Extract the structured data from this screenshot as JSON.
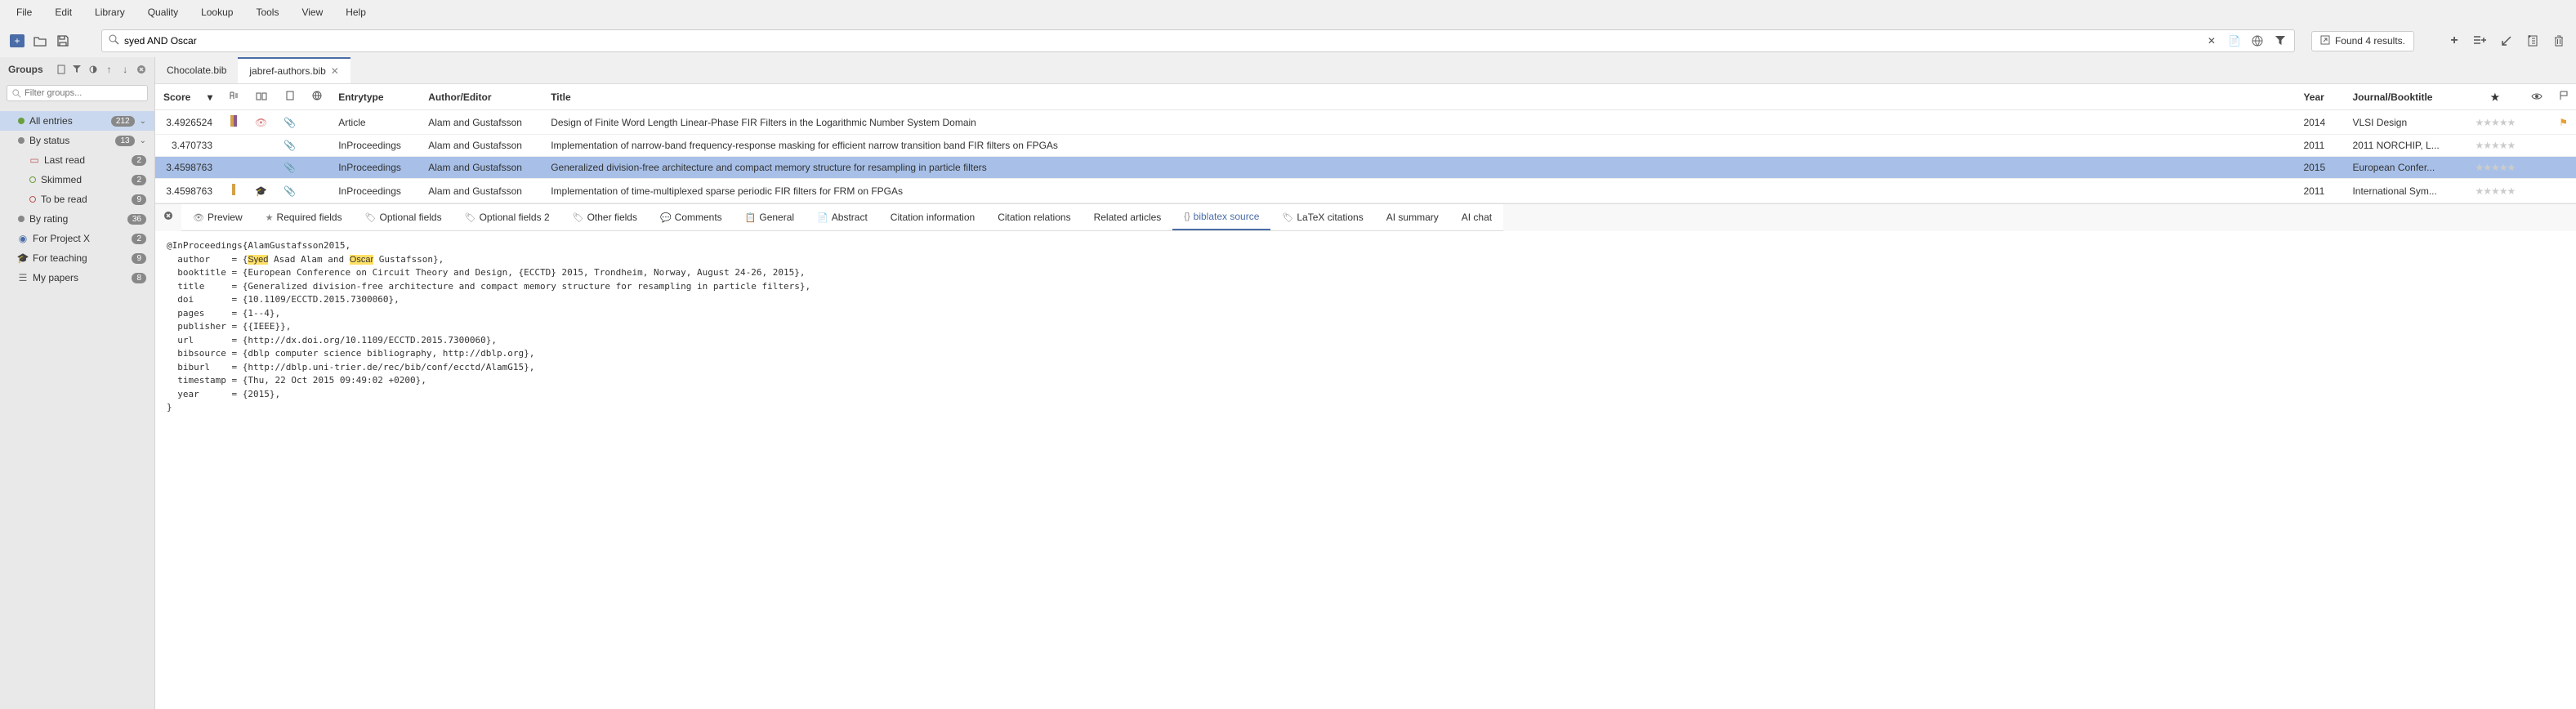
{
  "menubar": [
    "File",
    "Edit",
    "Library",
    "Quality",
    "Lookup",
    "Tools",
    "View",
    "Help"
  ],
  "search": {
    "value": "syed AND Oscar",
    "results_text": "Found 4 results."
  },
  "sidebar": {
    "title": "Groups",
    "filter_placeholder": "Filter groups...",
    "groups": [
      {
        "icon": "dot",
        "color": "#6a9e3f",
        "label": "All entries",
        "count": "212",
        "selected": true,
        "expand": true,
        "indent": 1
      },
      {
        "icon": "dot",
        "color": "#888",
        "label": "By status",
        "count": "13",
        "expand": true,
        "indent": 1
      },
      {
        "icon": "book",
        "color": "#b55",
        "label": "Last read",
        "count": "2",
        "indent": 2
      },
      {
        "icon": "dot-open",
        "color": "#6a9e3f",
        "label": "Skimmed",
        "count": "2",
        "indent": 2
      },
      {
        "icon": "dot-open",
        "color": "#b55",
        "label": "To be read",
        "count": "9",
        "indent": 2
      },
      {
        "icon": "dot",
        "color": "#888",
        "label": "By rating",
        "count": "36",
        "indent": 1
      },
      {
        "icon": "target",
        "color": "#4a6da7",
        "label": "For Project X",
        "count": "2",
        "indent": 1
      },
      {
        "icon": "grad",
        "color": "#4a6da7",
        "label": "For teaching",
        "count": "9",
        "indent": 1
      },
      {
        "icon": "layers",
        "color": "#666",
        "label": "My papers",
        "count": "8",
        "indent": 1
      }
    ]
  },
  "file_tabs": [
    {
      "label": "Chocolate.bib",
      "active": false
    },
    {
      "label": "jabref-authors.bib",
      "active": true
    }
  ],
  "table": {
    "columns": [
      "Score",
      "",
      "",
      "",
      "",
      "Entrytype",
      "Author/Editor",
      "Title",
      "Year",
      "Journal/Booktitle",
      "★",
      "👁",
      "🏳"
    ],
    "rows": [
      {
        "score": "3.4926524",
        "marks": [
          "|",
          "|"
        ],
        "eye": true,
        "clip": true,
        "type": "Article",
        "author": "Alam and Gustafsson",
        "title": "Design of Finite Word Length Linear-Phase FIR Filters in the Logarithmic Number System Domain",
        "year": "2014",
        "journal": "VLSI Design",
        "flag": true
      },
      {
        "score": "3.470733",
        "clip": true,
        "type": "InProceedings",
        "author": "Alam and Gustafsson",
        "title": "Implementation of narrow-band frequency-response masking for efficient narrow transition band FIR filters on FPGAs",
        "year": "2011",
        "journal": "2011 NORCHIP, L..."
      },
      {
        "score": "3.4598763",
        "clip": true,
        "type": "InProceedings",
        "author": "Alam and Gustafsson",
        "title": "Generalized division-free architecture and compact memory structure for resampling in particle filters",
        "year": "2015",
        "journal": "European Confer...",
        "selected": true
      },
      {
        "score": "3.4598763",
        "marks": [
          "|"
        ],
        "grad": true,
        "clip": true,
        "type": "InProceedings",
        "author": "Alam and Gustafsson",
        "title": "Implementation of time-multiplexed sparse periodic FIR filters for FRM on FPGAs",
        "year": "2011",
        "journal": "International Sym..."
      }
    ]
  },
  "editor_tabs": [
    {
      "icon": "👁",
      "label": "Preview"
    },
    {
      "icon": "★",
      "label": "Required fields"
    },
    {
      "icon": "🏷",
      "label": "Optional fields"
    },
    {
      "icon": "🏷",
      "label": "Optional fields 2"
    },
    {
      "icon": "🏷",
      "label": "Other fields"
    },
    {
      "icon": "💬",
      "label": "Comments"
    },
    {
      "icon": "📋",
      "label": "General"
    },
    {
      "icon": "📄",
      "label": "Abstract"
    },
    {
      "icon": "",
      "label": "Citation information"
    },
    {
      "icon": "",
      "label": "Citation relations"
    },
    {
      "icon": "",
      "label": "Related articles"
    },
    {
      "icon": "{}",
      "label": "biblatex source",
      "active": true
    },
    {
      "icon": "🏷",
      "label": "LaTeX citations"
    },
    {
      "icon": "",
      "label": "AI summary"
    },
    {
      "icon": "",
      "label": "AI chat"
    }
  ],
  "source": {
    "line1": "@InProceedings{AlamGustafsson2015,",
    "author_pre": "  author    = {",
    "author_hl1": "Syed",
    "author_mid": " Asad Alam and ",
    "author_hl2": "Oscar",
    "author_post": " Gustafsson},",
    "booktitle": "  booktitle = {European Conference on Circuit Theory and Design, {ECCTD} 2015, Trondheim, Norway, August 24-26, 2015},",
    "title": "  title     = {Generalized division-free architecture and compact memory structure for resampling in particle filters},",
    "doi": "  doi       = {10.1109/ECCTD.2015.7300060},",
    "pages": "  pages     = {1--4},",
    "publisher": "  publisher = {{IEEE}},",
    "url": "  url       = {http://dx.doi.org/10.1109/ECCTD.2015.7300060},",
    "bibsource": "  bibsource = {dblp computer science bibliography, http://dblp.org},",
    "biburl": "  biburl    = {http://dblp.uni-trier.de/rec/bib/conf/ecctd/AlamG15},",
    "timestamp": "  timestamp = {Thu, 22 Oct 2015 09:49:02 +0200},",
    "year": "  year      = {2015},",
    "close": "}"
  }
}
